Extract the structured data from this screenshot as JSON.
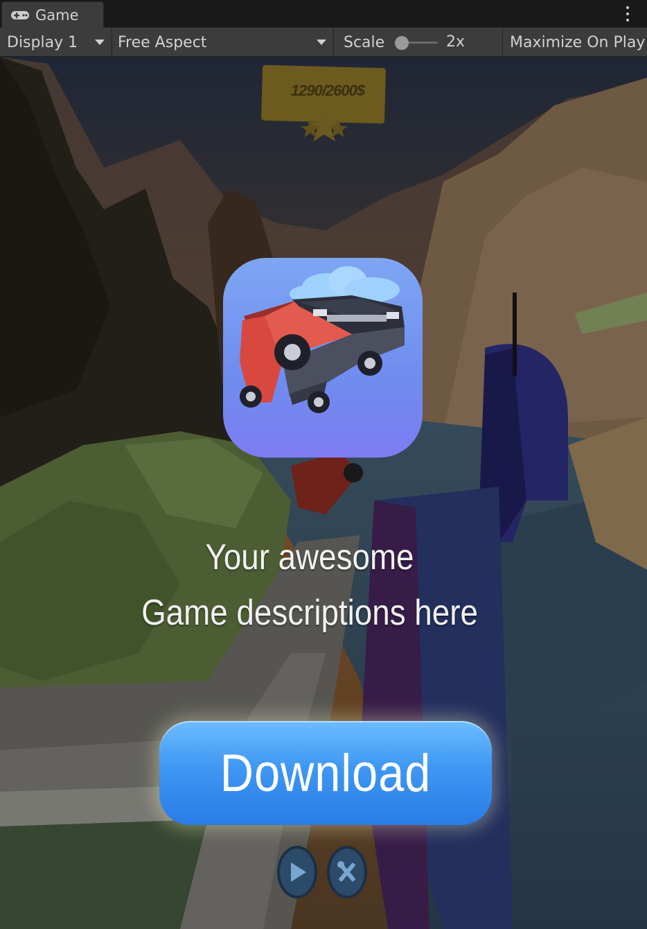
{
  "window": {
    "tab_label": "Game",
    "tab_icon": "gamepad-icon",
    "menu_icon": "kebab-menu-icon"
  },
  "toolbar": {
    "display": "Display 1",
    "aspect": "Free Aspect",
    "scale_label": "Scale",
    "scale_value": "2x",
    "maximize": "Maximize On Play"
  },
  "game": {
    "hud_progress": "1290/2600$",
    "app_icon": "pickup-truck-app-icon",
    "description_line1": "Your awesome",
    "description_line2": "Game descriptions here",
    "download_label": "Download",
    "play_icon": "play-icon",
    "tools_icon": "wrench-screwdriver-icon"
  },
  "colors": {
    "editor_bg": "#191919",
    "toolbar_bg": "#3c3c3c",
    "download_blue": "#3f97f3",
    "icon_sky": "#7ea6f3"
  }
}
